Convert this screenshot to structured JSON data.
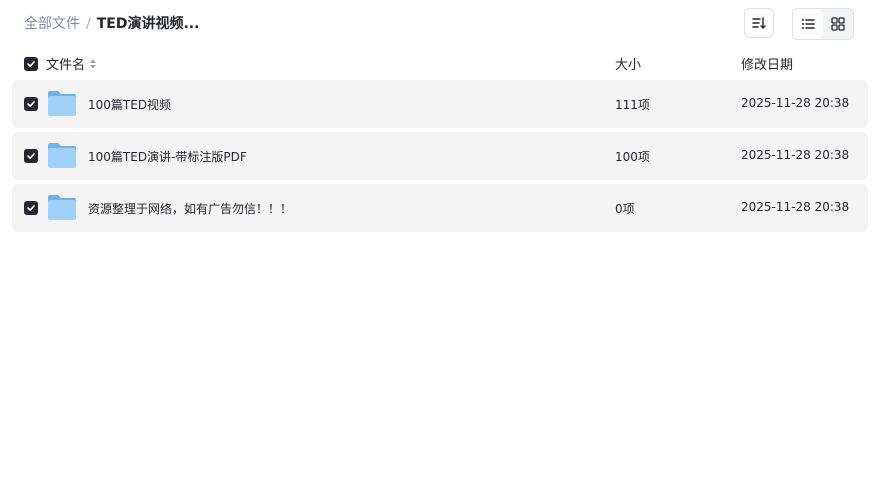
{
  "breadcrumb": {
    "root": "全部文件",
    "separator": "/",
    "current": "TED演讲视频..."
  },
  "toolbar": {
    "sort_icon": "sort-icon",
    "list_view_icon": "list-view-icon",
    "grid_view_icon": "grid-view-icon"
  },
  "header": {
    "name": "文件名",
    "size": "大小",
    "date": "修改日期"
  },
  "files": [
    {
      "name": "100篇TED视频",
      "size": "111项",
      "date": "2025-11-28 20:38"
    },
    {
      "name": "100篇TED演讲-带标注版PDF",
      "size": "100项",
      "date": "2025-11-28 20:38"
    },
    {
      "name": "资源整理于网络，如有广告勿信！！！",
      "size": "0项",
      "date": "2025-11-28 20:38"
    }
  ],
  "colors": {
    "row_bg": "#f4f4f5",
    "checkbox": "#25262b",
    "folder": "#8cc4f5"
  }
}
